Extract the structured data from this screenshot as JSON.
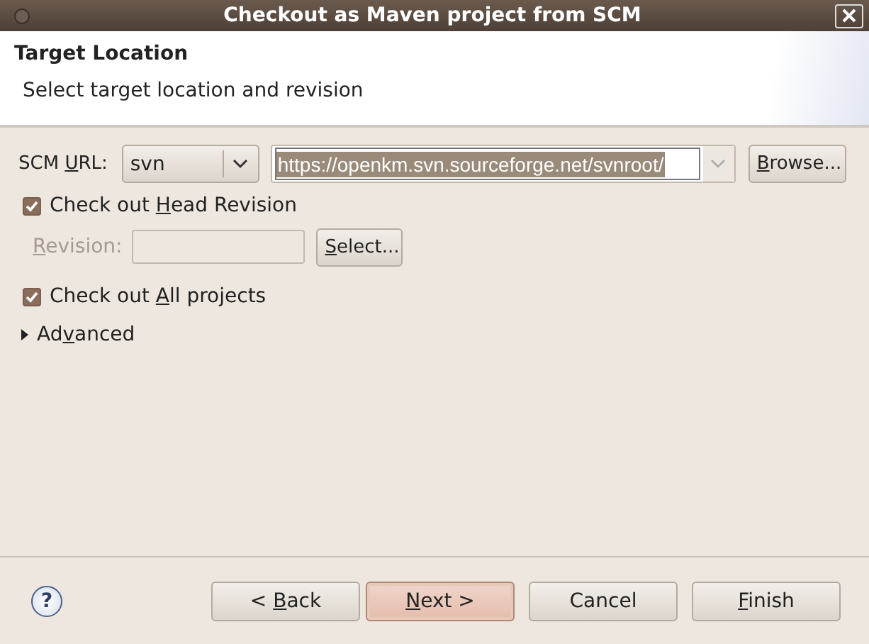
{
  "window": {
    "title": "Checkout as Maven project from SCM"
  },
  "header": {
    "title": "Target Location",
    "description": "Select target location and revision"
  },
  "scm": {
    "label": {
      "before": "SCM ",
      "key": "U",
      "after": "RL:"
    },
    "type": "svn",
    "url": "https://openkm.svn.sourceforge.net/svnroot/",
    "url_selected": true,
    "browse": {
      "key": "B",
      "after": "rowse..."
    }
  },
  "head_revision": {
    "label": {
      "before": "Check out ",
      "key": "H",
      "after": "ead Revision"
    },
    "checked": true
  },
  "revision": {
    "label": {
      "key": "R",
      "after": "evision:"
    },
    "disabled": true,
    "select": {
      "key": "S",
      "after": "elect..."
    }
  },
  "all_projects": {
    "label": {
      "before": "Check out ",
      "key": "A",
      "after": "ll projects"
    },
    "checked": true
  },
  "advanced": {
    "label": {
      "before": "Ad",
      "key": "v",
      "after": "anced"
    },
    "expanded": false
  },
  "help": "?",
  "buttons": [
    {
      "label": {
        "before": "< ",
        "key": "B",
        "after": "ack"
      },
      "default": false
    },
    {
      "label": {
        "key": "N",
        "after": "ext >"
      },
      "default": true
    },
    {
      "label": {
        "before": "Cancel"
      },
      "default": false
    },
    {
      "label": {
        "key": "F",
        "after": "inish"
      },
      "default": false
    }
  ]
}
